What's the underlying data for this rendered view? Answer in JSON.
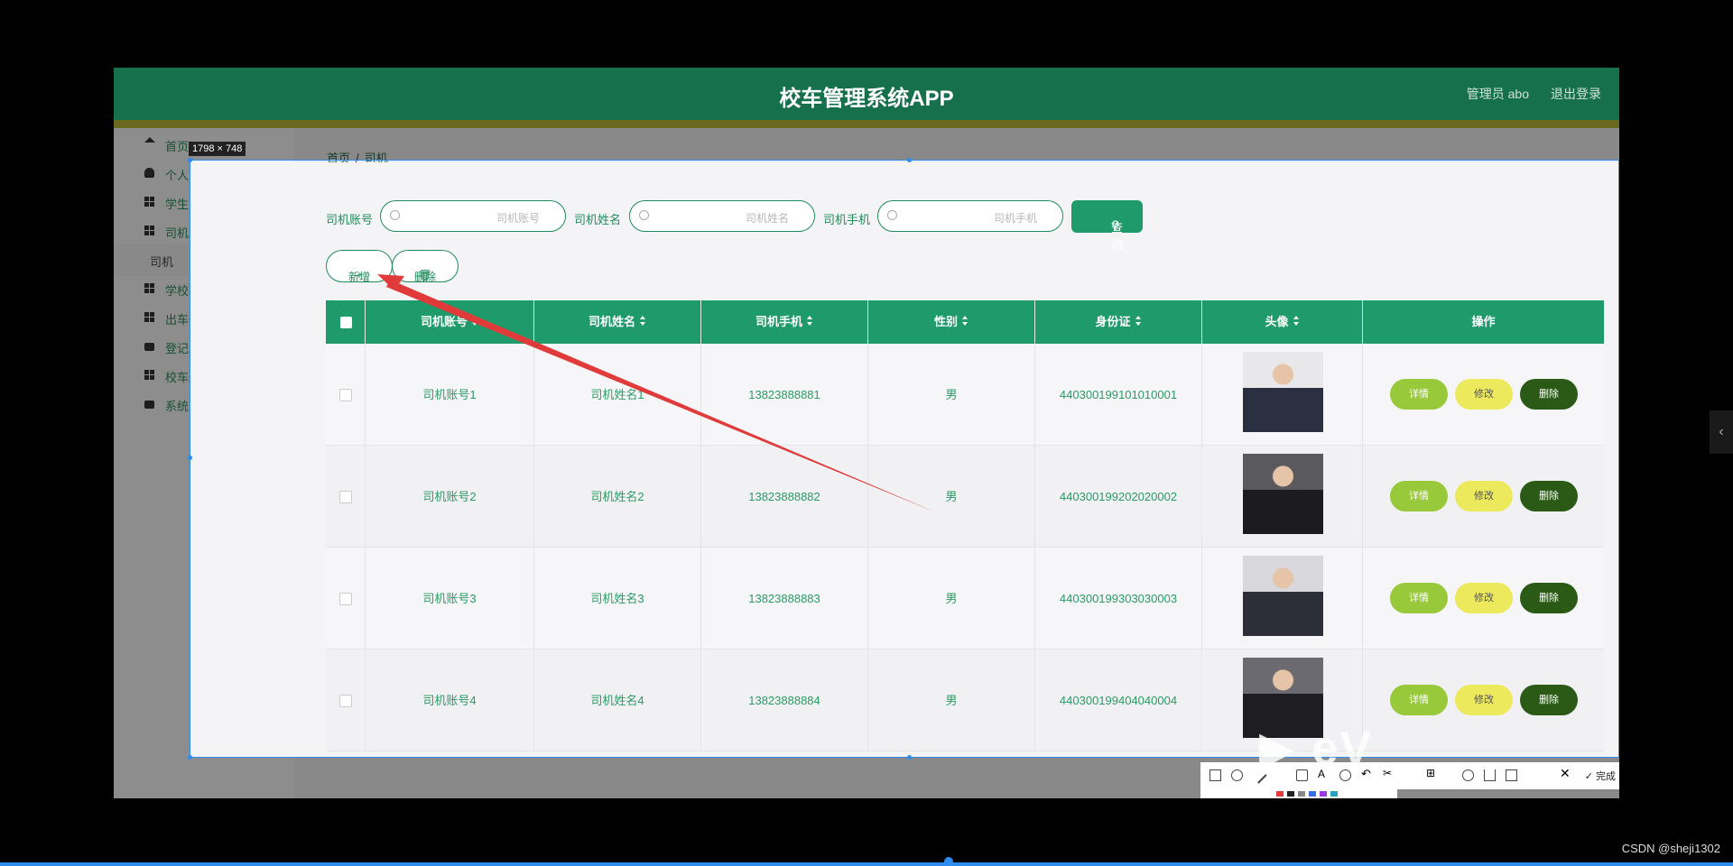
{
  "header": {
    "app_title": "校车管理系统APP",
    "user_label": "管理员 abo",
    "logout": "退出登录"
  },
  "sidebar": {
    "items": [
      {
        "label": "首页",
        "icon": "home-icon"
      },
      {
        "label": "个人中心",
        "icon": "person-icon"
      },
      {
        "label": "学生管理",
        "icon": "grid-icon"
      },
      {
        "label": "司机管理",
        "icon": "grid-icon"
      },
      {
        "label": "学校校车管理",
        "icon": "grid-icon"
      },
      {
        "label": "出车信息管理",
        "icon": "grid-icon"
      },
      {
        "label": "登记上车管理",
        "icon": "briefcase-icon"
      },
      {
        "label": "校车返校管理",
        "icon": "grid-icon"
      },
      {
        "label": "系统管理",
        "icon": "briefcase-icon"
      }
    ],
    "active_sub": "司机"
  },
  "screenshot_tool": {
    "size_tag": "1798 × 748",
    "done_label": "完成"
  },
  "breadcrumb": {
    "home": "首页",
    "sep": "/",
    "current": "司机"
  },
  "search": {
    "fields": [
      {
        "label": "司机账号",
        "placeholder": "司机账号"
      },
      {
        "label": "司机姓名",
        "placeholder": "司机姓名"
      },
      {
        "label": "司机手机",
        "placeholder": "司机手机"
      }
    ],
    "query_label": "查询"
  },
  "actions": {
    "add_label": "新增",
    "delete_label": "删除"
  },
  "table": {
    "columns": [
      "司机账号",
      "司机姓名",
      "司机手机",
      "性别",
      "身份证",
      "头像",
      "操作"
    ],
    "row_actions": {
      "detail": "详情",
      "edit": "修改",
      "delete": "删除"
    },
    "rows": [
      {
        "account": "司机账号1",
        "name": "司机姓名1",
        "phone": "13823888881",
        "gender": "男",
        "id_card": "440300199101010001"
      },
      {
        "account": "司机账号2",
        "name": "司机姓名2",
        "phone": "13823888882",
        "gender": "男",
        "id_card": "440300199202020002"
      },
      {
        "account": "司机账号3",
        "name": "司机姓名3",
        "phone": "13823888883",
        "gender": "男",
        "id_card": "440300199303030003"
      },
      {
        "account": "司机账号4",
        "name": "司机姓名4",
        "phone": "13823888884",
        "gender": "男",
        "id_card": "440300199404040004"
      }
    ]
  },
  "colors": {
    "primary": "#1f9a6a",
    "header": "#17704c",
    "accent_stripe": "#b8b43a",
    "annotation_arrow": "#e03a3a",
    "selection": "#2d8cf0"
  },
  "footer": {
    "watermark": "CSDN @sheji1302"
  }
}
